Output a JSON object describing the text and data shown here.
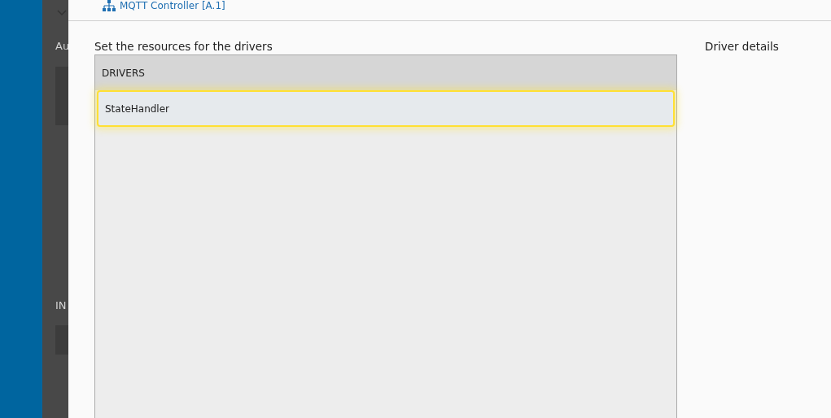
{
  "background_page": {
    "labels": [
      "Au",
      "IN"
    ]
  },
  "dialog": {
    "title": "MQTT Controller [A.1]",
    "instruction": "Set the resources for the drivers",
    "details_heading": "Driver details",
    "drivers": {
      "column": "DRIVERS",
      "rows": [
        {
          "name": "StateHandler",
          "selected": true
        }
      ]
    }
  }
}
